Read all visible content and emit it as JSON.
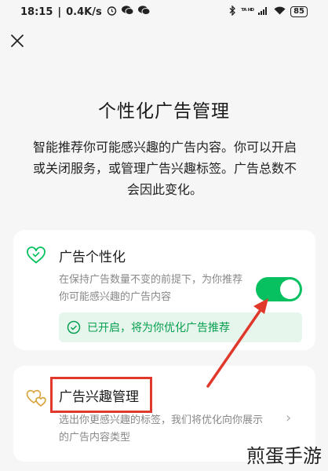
{
  "status_bar": {
    "time": "18:15",
    "net_speed": "0.4K/s",
    "signal": "ᵀᴬ ᴴᴰ",
    "battery": "85"
  },
  "page": {
    "title": "个性化广告管理",
    "intro": "智能推荐你可能感兴趣的广告内容。你可以开启或关闭服务，或管理广告兴趣标签。广告总数不会因此变化。"
  },
  "personalization": {
    "title": "广告个性化",
    "description": "在保持广告数量不变的前提下，为你推荐你可能感兴趣的广告内容",
    "toggle_on": true,
    "status": "已开启，将为你优化广告推荐"
  },
  "interests": {
    "title": "广告兴趣管理",
    "description": "选出你更感兴趣的标签，我们将优化向你展示的广告内容类型",
    "chevron": "›"
  },
  "watermark": "煎蛋手游",
  "colors": {
    "accent": "#07c160",
    "annotation": "#e0382a"
  }
}
